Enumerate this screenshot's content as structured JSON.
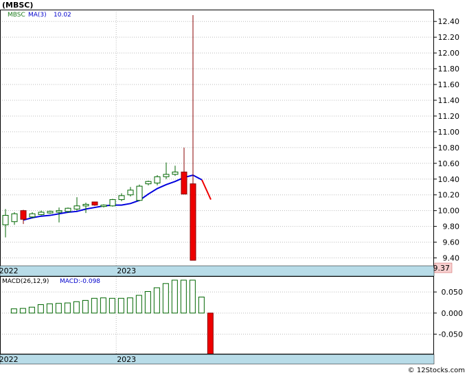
{
  "chart_data": [
    {
      "type": "candlestick",
      "title": "(MBSC)",
      "ticker": "MBSC",
      "ma_label": "MA(3)",
      "ma_value": "10.02",
      "last_price": "9.37",
      "ylim": [
        9.3,
        12.55
      ],
      "y_ticks": [
        {
          "v": 9.4,
          "label": "9.40"
        },
        {
          "v": 9.6,
          "label": "9.60"
        },
        {
          "v": 9.8,
          "label": "9.80"
        },
        {
          "v": 10.0,
          "label": "10.00"
        },
        {
          "v": 10.2,
          "label": "10.20"
        },
        {
          "v": 10.4,
          "label": "10.40"
        },
        {
          "v": 10.6,
          "label": "10.60"
        },
        {
          "v": 10.8,
          "label": "10.80"
        },
        {
          "v": 11.0,
          "label": "11.00"
        },
        {
          "v": 11.2,
          "label": "11.20"
        },
        {
          "v": 11.4,
          "label": "11.40"
        },
        {
          "v": 11.6,
          "label": "11.60"
        },
        {
          "v": 11.8,
          "label": "11.80"
        },
        {
          "v": 12.0,
          "label": "12.00"
        },
        {
          "v": 12.2,
          "label": "12.20"
        },
        {
          "v": 12.4,
          "label": "12.40"
        }
      ],
      "x_labels": [
        {
          "label": "2022",
          "index": -0.8
        },
        {
          "label": "2023",
          "index": 12.4
        }
      ],
      "candles": [
        {
          "o": 9.82,
          "h": 10.02,
          "l": 9.66,
          "c": 9.94,
          "up": true
        },
        {
          "o": 9.86,
          "h": 9.98,
          "l": 9.82,
          "c": 9.96,
          "up": true
        },
        {
          "o": 10.0,
          "h": 10.01,
          "l": 9.83,
          "c": 9.89,
          "up": false
        },
        {
          "o": 9.92,
          "h": 9.98,
          "l": 9.9,
          "c": 9.96,
          "up": true
        },
        {
          "o": 9.95,
          "h": 10.0,
          "l": 9.94,
          "c": 9.98,
          "up": true
        },
        {
          "o": 9.97,
          "h": 10.0,
          "l": 9.96,
          "c": 9.99,
          "up": true
        },
        {
          "o": 9.98,
          "h": 10.04,
          "l": 9.85,
          "c": 10.0,
          "up": true
        },
        {
          "o": 9.99,
          "h": 10.04,
          "l": 9.97,
          "c": 10.03,
          "up": true
        },
        {
          "o": 10.02,
          "h": 10.17,
          "l": 10.0,
          "c": 10.06,
          "up": true
        },
        {
          "o": 10.06,
          "h": 10.1,
          "l": 9.97,
          "c": 10.08,
          "up": true
        },
        {
          "o": 10.11,
          "h": 10.11,
          "l": 10.06,
          "c": 10.07,
          "up": false
        },
        {
          "o": 10.07,
          "h": 10.08,
          "l": 10.04,
          "c": 10.06,
          "up": true
        },
        {
          "o": 10.06,
          "h": 10.15,
          "l": 10.05,
          "c": 10.14,
          "up": true
        },
        {
          "o": 10.14,
          "h": 10.22,
          "l": 10.12,
          "c": 10.19,
          "up": true
        },
        {
          "o": 10.2,
          "h": 10.3,
          "l": 10.18,
          "c": 10.26,
          "up": true
        },
        {
          "o": 10.13,
          "h": 10.33,
          "l": 10.12,
          "c": 10.31,
          "up": true
        },
        {
          "o": 10.34,
          "h": 10.38,
          "l": 10.32,
          "c": 10.37,
          "up": true
        },
        {
          "o": 10.35,
          "h": 10.45,
          "l": 10.32,
          "c": 10.43,
          "up": true
        },
        {
          "o": 10.43,
          "h": 10.61,
          "l": 10.4,
          "c": 10.46,
          "up": true
        },
        {
          "o": 10.46,
          "h": 10.57,
          "l": 10.44,
          "c": 10.49,
          "up": true
        },
        {
          "o": 10.49,
          "h": 10.8,
          "l": 10.21,
          "c": 10.21,
          "up": false
        },
        {
          "o": 10.34,
          "h": 12.48,
          "l": 9.37,
          "c": 9.37,
          "up": false
        }
      ],
      "ma": [
        9.88,
        9.91,
        9.93,
        9.94,
        9.96,
        9.98,
        9.99,
        10.02,
        10.04,
        10.06,
        10.07,
        10.07,
        10.09,
        10.13,
        10.21,
        10.28,
        10.33,
        10.37,
        10.42,
        10.45,
        10.39,
        10.14
      ]
    },
    {
      "type": "bar",
      "title": "MACD(26,12,9)",
      "macd_label": "MACD:-0.098",
      "ylim": [
        -0.098,
        0.086
      ],
      "y_ticks": [
        {
          "v": 0.05,
          "label": "0.050"
        },
        {
          "v": 0.0,
          "label": "0.000"
        },
        {
          "v": -0.05,
          "label": "-0.050"
        }
      ],
      "x_labels": [
        {
          "label": "2022",
          "index": -0.8
        },
        {
          "label": "2023",
          "index": 12.4
        }
      ],
      "values": [
        0.01,
        0.011,
        0.014,
        0.02,
        0.022,
        0.023,
        0.024,
        0.027,
        0.03,
        0.035,
        0.036,
        0.035,
        0.035,
        0.036,
        0.042,
        0.051,
        0.06,
        0.07,
        0.078,
        0.078,
        0.078,
        0.038,
        -0.098
      ]
    }
  ],
  "footer": {
    "copyright": "© 12Stocks.com"
  }
}
